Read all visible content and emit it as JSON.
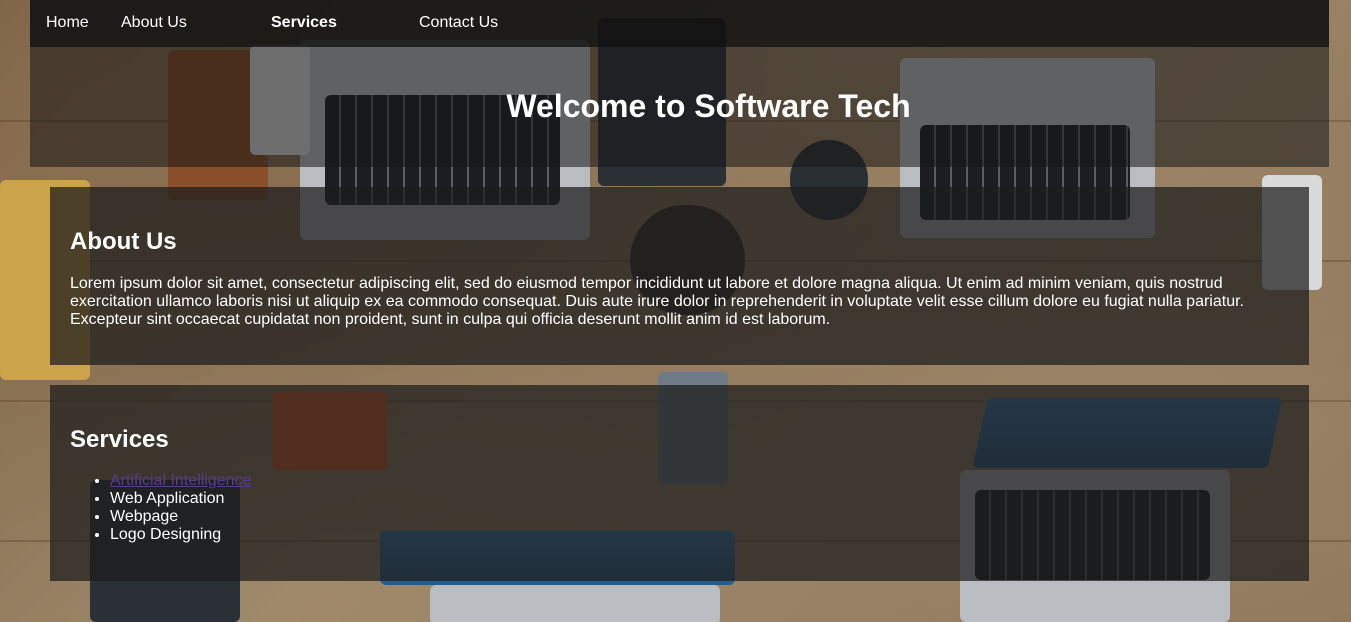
{
  "nav": {
    "items": [
      {
        "label": "Home",
        "active": false
      },
      {
        "label": "About Us",
        "active": false
      },
      {
        "label": "Services",
        "active": true
      },
      {
        "label": "Contact Us",
        "active": false
      }
    ]
  },
  "hero": {
    "title": "Welcome to Software Tech"
  },
  "about": {
    "heading": "About Us",
    "body": "Lorem ipsum dolor sit amet, consectetur adipiscing elit, sed do eiusmod tempor incididunt ut labore et dolore magna aliqua. Ut enim ad minim veniam, quis nostrud exercitation ullamco laboris nisi ut aliquip ex ea commodo consequat. Duis aute irure dolor in reprehenderit in voluptate velit esse cillum dolore eu fugiat nulla pariatur. Excepteur sint occaecat cupidatat non proident, sunt in culpa qui officia deserunt mollit anim id est laborum."
  },
  "services": {
    "heading": "Services",
    "items": [
      {
        "label": "Artificial Intelligence",
        "is_link": true
      },
      {
        "label": "Web Application",
        "is_link": false
      },
      {
        "label": "Webpage",
        "is_link": false
      },
      {
        "label": "Logo Designing",
        "is_link": false
      }
    ]
  },
  "colors": {
    "nav_bg": "#121212",
    "text": "#ffffff",
    "visited_link": "#5b3a8a"
  }
}
